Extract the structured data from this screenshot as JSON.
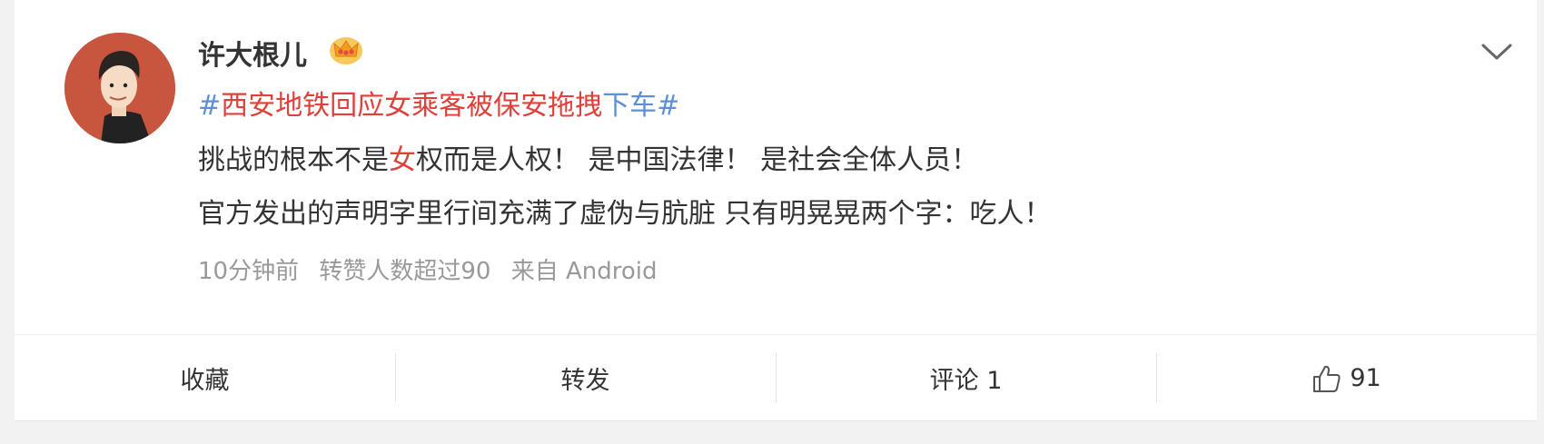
{
  "colors": {
    "link": "#5c8fd6",
    "highlight": "#e0403a",
    "text": "#333333",
    "meta": "#999999"
  },
  "post": {
    "username": "许大根儿",
    "badge_icon": "crown-icon",
    "topic": {
      "hash_open": "#",
      "red_text": "西安地铁回应女乘客被保安拖拽",
      "blue_text": "下车",
      "hash_close": "#"
    },
    "line1": {
      "before": "挑战的根本不是",
      "highlight": "女",
      "after": "权而是人权！ 是中国法律！ 是社会全体人员！"
    },
    "line2": "官方发出的声明字里行间充满了虚伪与肮脏 只有明晃晃两个字：吃人！",
    "meta": {
      "time": "10分钟前",
      "reposts_note": "转赞人数超过90",
      "source": "来自 Android"
    }
  },
  "actions": {
    "favorite": "收藏",
    "repost": "转发",
    "comment": "评论 1",
    "like_count": "91"
  }
}
